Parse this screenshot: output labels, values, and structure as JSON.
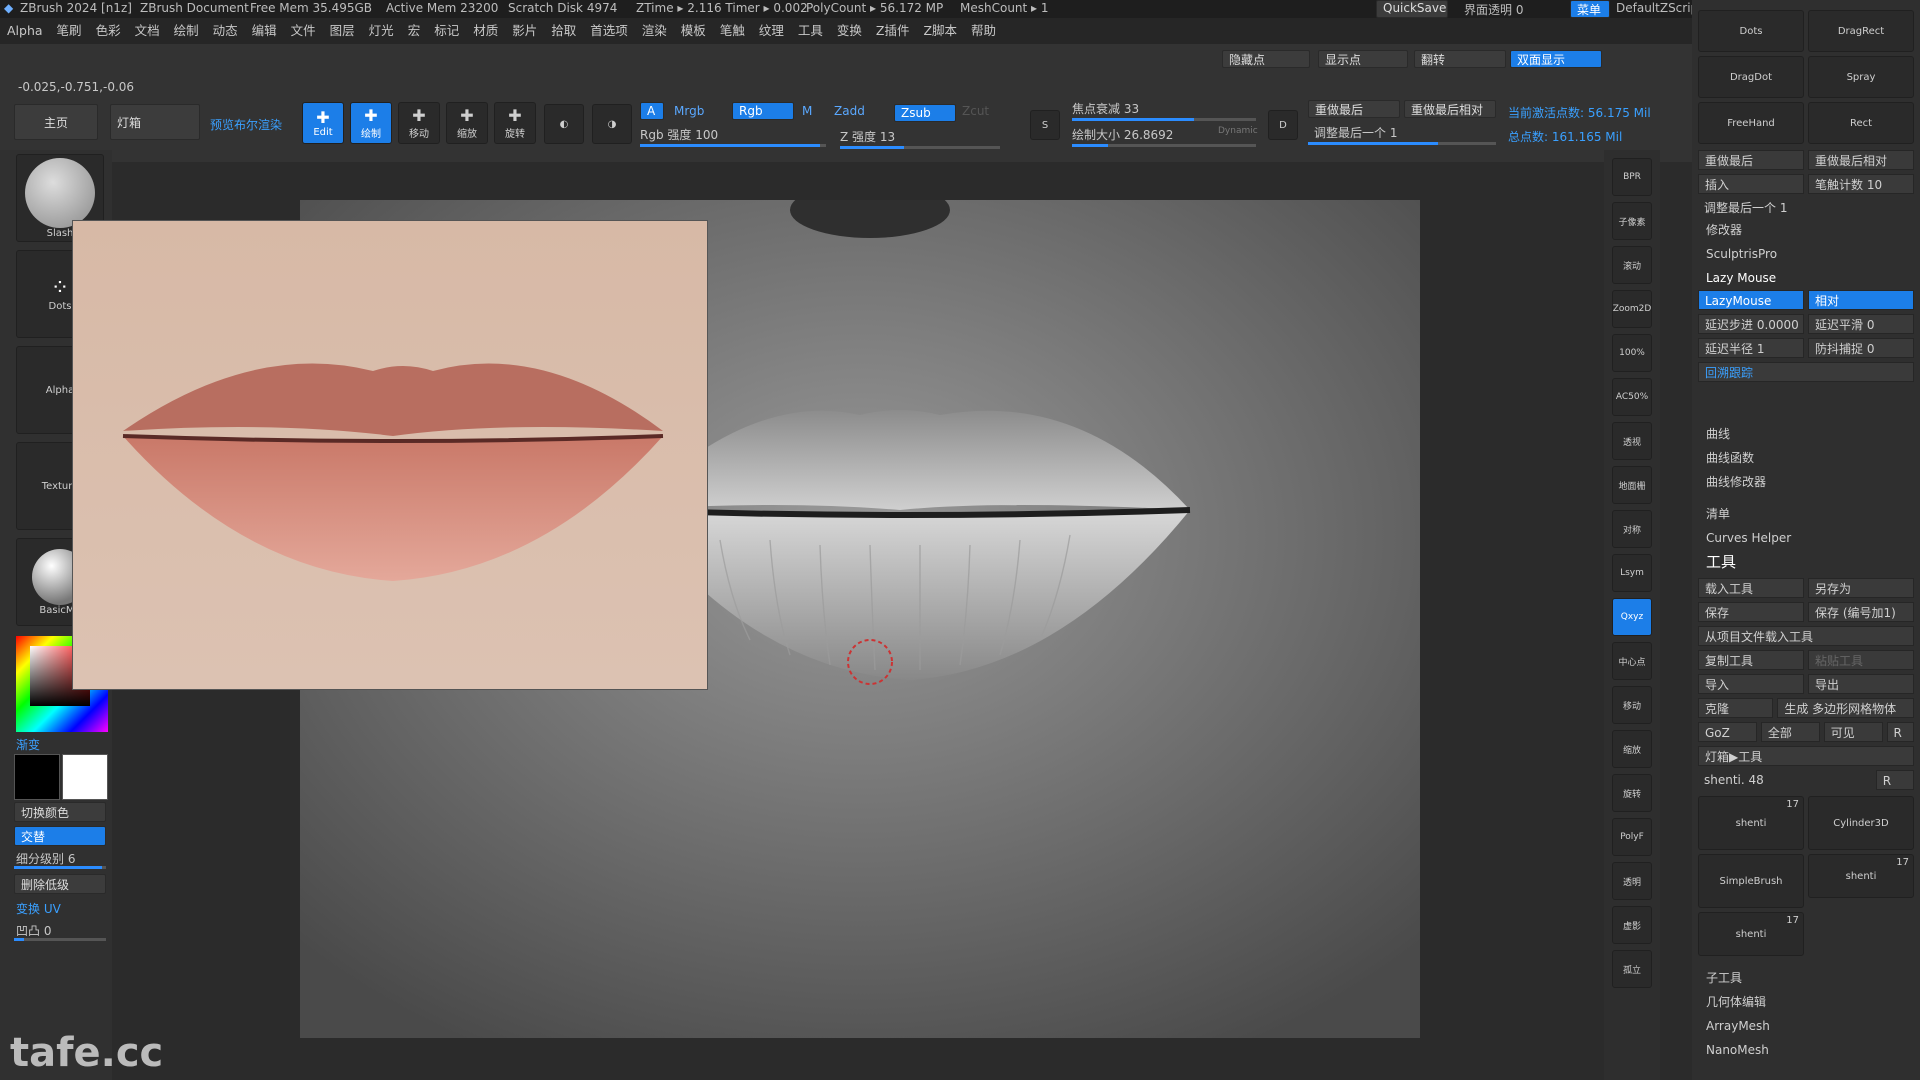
{
  "titlebar": {
    "app": "ZBrush 2024 [n1z]",
    "document": "ZBrush Document",
    "free_mem": "Free Mem 35.495GB",
    "active_mem": "Active Mem 23200",
    "scratch": "Scratch Disk 4974",
    "ztime": "ZTime ▸ 2.116 Timer ▸ 0.002",
    "polycount": "PolyCount ▸ 56.172 MP",
    "meshcount": "MeshCount ▸ 1",
    "quicksave": "QuickSave",
    "transparency": "界面透明 0",
    "menu": "菜单",
    "script": "DefaultZScript"
  },
  "menus": [
    "Alpha",
    "笔刷",
    "色彩",
    "文档",
    "绘制",
    "动态",
    "编辑",
    "文件",
    "图层",
    "灯光",
    "宏",
    "标记",
    "材质",
    "影片",
    "拾取",
    "首选项",
    "渲染",
    "模板",
    "笔触",
    "纹理",
    "工具",
    "变换",
    "Z插件",
    "Z脚本",
    "帮助"
  ],
  "display_buttons": {
    "hide_pts": "隐藏点",
    "show_pts": "显示点",
    "flip": "翻转",
    "double_sided": "双面显示"
  },
  "coords": "-0.025,-0.751,-0.06",
  "nav": {
    "home": "主页",
    "lightbox": "灯箱",
    "preview": "预览布尔渲染"
  },
  "tools": [
    {
      "label": "Edit",
      "icon": "edit-icon",
      "active": true
    },
    {
      "label": "绘制",
      "icon": "draw-icon",
      "active": true
    },
    {
      "label": "移动",
      "icon": "move-icon",
      "active": false
    },
    {
      "label": "缩放",
      "icon": "scale-icon",
      "active": false
    },
    {
      "label": "旋转",
      "icon": "rotate-icon",
      "active": false
    }
  ],
  "color_mode": {
    "a": "A",
    "mrgb": "Mrgb",
    "rgb": "Rgb",
    "m": "M",
    "zadd": "Zadd",
    "zsub": "Zsub",
    "zcut": "Zcut"
  },
  "sliders": {
    "rgb_intensity": "Rgb 强度 100",
    "z_intensity": "Z 强度 13",
    "focal_shift": "焦点衰减 33",
    "draw_size": "绘制大小 26.8692",
    "dynamic": "Dynamic"
  },
  "redo": {
    "last": "重做最后",
    "last_rel": "重做最后相对",
    "adjust": "调整最后一个 1"
  },
  "stats": {
    "active_points": "当前激活点数: 56.175 Mil",
    "total_points": "总点数: 161.165 Mil"
  },
  "left_panel": {
    "brush": "Slash",
    "stroke": "Dots",
    "alpha": "Alpha",
    "texture": "Texture",
    "material": "BasicMa",
    "gradient": "渐变",
    "switch_color": "切换颜色",
    "alternate": "交替",
    "subdiv": "细分级别 6",
    "del_lower": "删除低级",
    "uv": "变换 UV",
    "bump": "凹凸 0"
  },
  "right_shelf": [
    "BPR",
    "子像素",
    "滚动",
    "Zoom2D",
    "100%",
    "AC50%",
    "透视",
    "地面栅",
    "对称",
    "Lsym",
    "Qxyz",
    "中心点",
    "移动",
    "缩放",
    "旋转",
    "PolyF",
    "透明",
    "虚影",
    "孤立"
  ],
  "right_panel": {
    "strokes": [
      "Dots",
      "DragRect",
      "DragDot",
      "Spray",
      "FreeHand",
      "Rect"
    ],
    "redo_last": "重做最后",
    "redo_rel": "重做最后相对",
    "insert": "插入",
    "stroke_count": "笔触计数 10",
    "adjust_last": "调整最后一个 1",
    "modifiers": "修改器",
    "sculptris": "SculptrisPro",
    "lazy_mouse": "Lazy Mouse",
    "lazy_btn": "LazyMouse",
    "relative": "相对",
    "lazy_step": "延迟步进 0.0000",
    "lazy_smooth": "延迟平滑 0",
    "lazy_radius": "延迟半径 1",
    "backtrack": "防抖捕捉 0",
    "trace": "回溯跟踪",
    "curve": "曲线",
    "curve_func": "曲线函数",
    "curve_mod": "曲线修改器",
    "list": "清单",
    "curves_helper": "Curves Helper",
    "tool_title": "工具",
    "load_tool": "载入工具",
    "save_as": "另存为",
    "save": "保存",
    "save_inc": "保存 (编号加1)",
    "load_from_project": "从项目文件载入工具",
    "copy_tool": "复制工具",
    "paste_tool": "粘贴工具",
    "import": "导入",
    "export": "导出",
    "clone": "克隆",
    "make_polymesh": "生成 多边形网格物体",
    "goz": "GoZ",
    "all": "全部",
    "visible": "可见",
    "r": "R",
    "lightbox_tool": "灯箱▶工具",
    "shenti": "shenti. 48",
    "thumbs": [
      "shenti",
      "Cylinder3D",
      "SimpleBrush",
      "shenti",
      "shenti"
    ],
    "thumb_count": "17",
    "subtool": "子工具",
    "geometry": "几何体编辑",
    "arraymesh": "ArrayMesh",
    "nanomesh": "NanoMesh"
  },
  "watermark": "tafe.cc",
  "colors": {
    "accent": "#1c7ee8",
    "panel": "#303030",
    "bg": "#2b2b2b"
  }
}
